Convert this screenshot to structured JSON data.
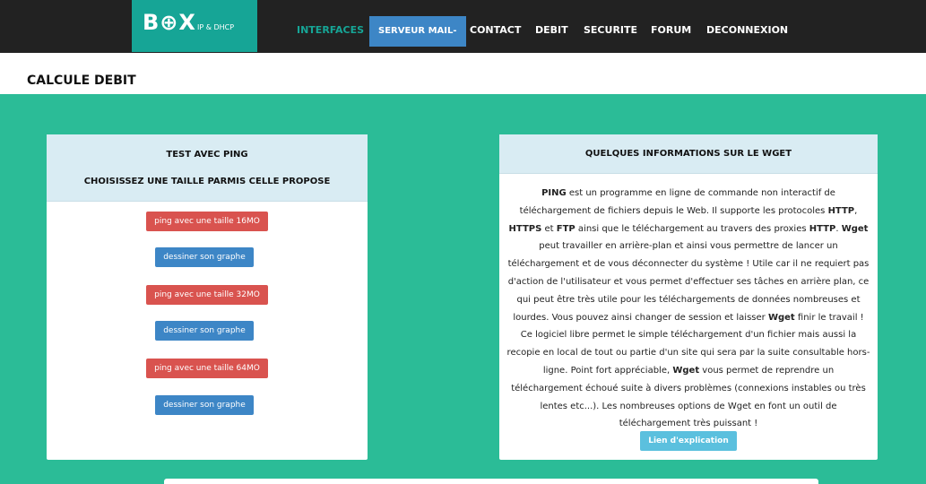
{
  "nav": {
    "brand": "B⊕X",
    "brand_sub": "IP & DHCP",
    "items": [
      "INTERFACES",
      "SERVEUR MAIL-",
      "CONTACT",
      "DEBIT",
      "SECURITE",
      "FORUM",
      "DECONNEXION"
    ]
  },
  "page_title": "CALCULE DEBIT",
  "left_panel": {
    "heading1": "TEST AVEC PING",
    "heading2": "CHOISISSEZ UNE TAILLE PARMIS CELLE PROPOSE",
    "buttons": [
      "ping avec une taille 16MO",
      "dessiner son graphe",
      "ping avec une taille 32MO",
      "dessiner son graphe",
      "ping avec une taille 64MO",
      "dessiner son graphe"
    ]
  },
  "right_panel": {
    "heading": "QUELQUES INFORMATIONS SUR LE WGET",
    "text_parts": [
      {
        "b": "PING"
      },
      {
        "t": " est un programme en ligne de commande non interactif de téléchargement de fichiers depuis le Web. Il supporte les protocoles "
      },
      {
        "b": "HTTP"
      },
      {
        "t": ", "
      },
      {
        "b": "HTTPS"
      },
      {
        "t": " et "
      },
      {
        "b": "FTP"
      },
      {
        "t": " ainsi que le téléchargement au travers des proxies "
      },
      {
        "b": "HTTP"
      },
      {
        "t": ". "
      },
      {
        "b": "Wget"
      },
      {
        "t": " peut travailler en arrière-plan et ainsi vous permettre de lancer un téléchargement et de vous déconnecter du système ! Utile car il ne requiert pas d'action de l'utilisateur et vous permet d'effectuer ses tâches en arrière plan, ce qui peut être très utile pour les téléchargements de données nombreuses et lourdes. Vous pouvez ainsi changer de session et laisser "
      },
      {
        "b": "Wget"
      },
      {
        "t": " finir le travail ! Ce logiciel libre permet le simple téléchargement d'un fichier mais aussi la recopie en local de tout ou partie d'un site qui sera par la suite consultable hors-ligne. Point fort appréciable, "
      },
      {
        "b": "Wget"
      },
      {
        "t": " vous permet de reprendre un téléchargement échoué suite à divers problèmes (connexions instables ou très lentes etc...). Les nombreuses options de Wget en font un outil de téléchargement très puissant !"
      }
    ],
    "link_button": "Lien d'explication"
  },
  "colors": {
    "navbar": "#222222",
    "brand": "#16a596",
    "green_bg": "#2bbc97",
    "panel_head": "#d9ecf3",
    "btn_red": "#d9534f",
    "btn_blue": "#3d86c6",
    "btn_info": "#5bc0de"
  }
}
